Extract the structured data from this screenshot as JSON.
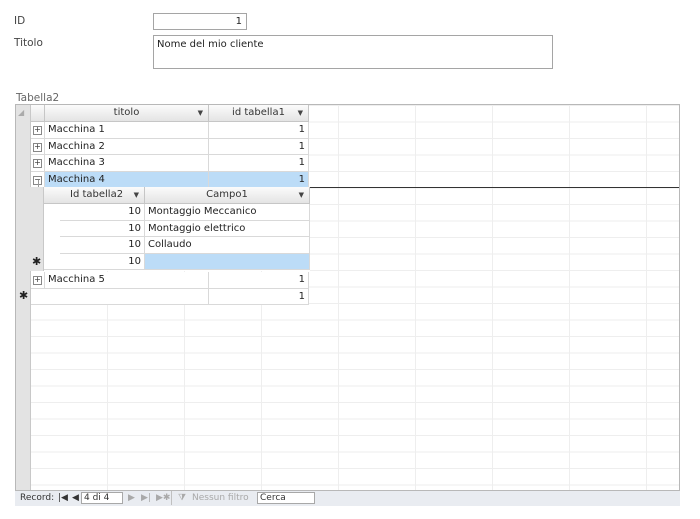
{
  "form": {
    "id_label": "ID",
    "id_value": "1",
    "titolo_label": "Titolo",
    "titolo_value": "Nome del mio cliente",
    "subform_label": "Tabella2"
  },
  "datasheet": {
    "columns": [
      "titolo",
      "id tabella1"
    ],
    "rows": [
      {
        "titolo": "Macchina 1",
        "id": "1",
        "expander": "⊞"
      },
      {
        "titolo": "Macchina 2",
        "id": "1",
        "expander": "⊞"
      },
      {
        "titolo": "Macchina 3",
        "id": "1",
        "expander": "⊞"
      },
      {
        "titolo": "Macchina 4",
        "id": "1",
        "expander": "⊟"
      },
      {
        "titolo": "Macchina 5",
        "id": "1",
        "expander": "⊞"
      },
      {
        "titolo": "",
        "id": "1",
        "new_row_marker": "✱"
      }
    ],
    "subdatasheet": {
      "columns": [
        "Id tabella2",
        "Campo1"
      ],
      "rows": [
        {
          "id": "10",
          "campo": "Montaggio Meccanico"
        },
        {
          "id": "10",
          "campo": "Montaggio elettrico"
        },
        {
          "id": "10",
          "campo": "Collaudo"
        },
        {
          "id": "10",
          "campo": "",
          "new_row_marker": "✱"
        }
      ]
    }
  },
  "navigation": {
    "record_label": "Record:",
    "first_icon": "first-record-icon",
    "prev_icon": "prev-record-icon",
    "position": "4 di 4",
    "next_icon": "next-record-icon",
    "last_icon": "last-record-icon",
    "new_icon": "new-record-icon",
    "filter_label": "Nessun filtro",
    "search_placeholder": "Cerca"
  }
}
